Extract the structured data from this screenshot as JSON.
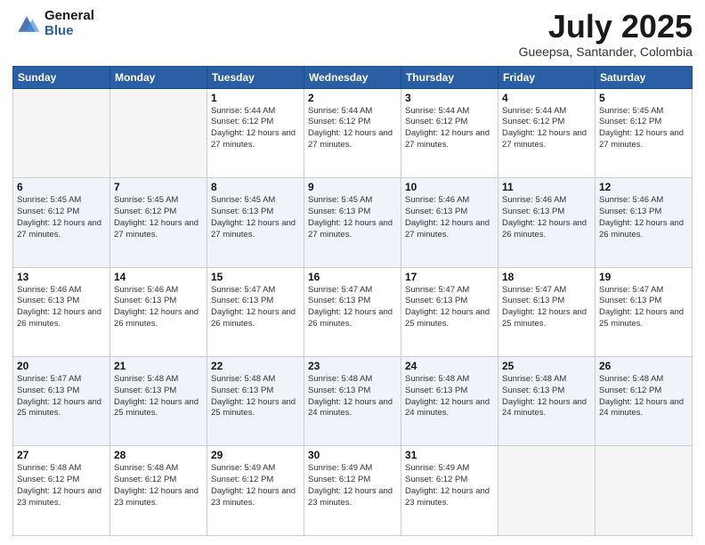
{
  "header": {
    "logo_general": "General",
    "logo_blue": "Blue",
    "month_title": "July 2025",
    "subtitle": "Gueepsa, Santander, Colombia"
  },
  "days_of_week": [
    "Sunday",
    "Monday",
    "Tuesday",
    "Wednesday",
    "Thursday",
    "Friday",
    "Saturday"
  ],
  "weeks": [
    [
      {
        "day": "",
        "sunrise": "",
        "sunset": "",
        "daylight": ""
      },
      {
        "day": "",
        "sunrise": "",
        "sunset": "",
        "daylight": ""
      },
      {
        "day": "1",
        "sunrise": "Sunrise: 5:44 AM",
        "sunset": "Sunset: 6:12 PM",
        "daylight": "Daylight: 12 hours and 27 minutes."
      },
      {
        "day": "2",
        "sunrise": "Sunrise: 5:44 AM",
        "sunset": "Sunset: 6:12 PM",
        "daylight": "Daylight: 12 hours and 27 minutes."
      },
      {
        "day": "3",
        "sunrise": "Sunrise: 5:44 AM",
        "sunset": "Sunset: 6:12 PM",
        "daylight": "Daylight: 12 hours and 27 minutes."
      },
      {
        "day": "4",
        "sunrise": "Sunrise: 5:44 AM",
        "sunset": "Sunset: 6:12 PM",
        "daylight": "Daylight: 12 hours and 27 minutes."
      },
      {
        "day": "5",
        "sunrise": "Sunrise: 5:45 AM",
        "sunset": "Sunset: 6:12 PM",
        "daylight": "Daylight: 12 hours and 27 minutes."
      }
    ],
    [
      {
        "day": "6",
        "sunrise": "Sunrise: 5:45 AM",
        "sunset": "Sunset: 6:12 PM",
        "daylight": "Daylight: 12 hours and 27 minutes."
      },
      {
        "day": "7",
        "sunrise": "Sunrise: 5:45 AM",
        "sunset": "Sunset: 6:12 PM",
        "daylight": "Daylight: 12 hours and 27 minutes."
      },
      {
        "day": "8",
        "sunrise": "Sunrise: 5:45 AM",
        "sunset": "Sunset: 6:13 PM",
        "daylight": "Daylight: 12 hours and 27 minutes."
      },
      {
        "day": "9",
        "sunrise": "Sunrise: 5:45 AM",
        "sunset": "Sunset: 6:13 PM",
        "daylight": "Daylight: 12 hours and 27 minutes."
      },
      {
        "day": "10",
        "sunrise": "Sunrise: 5:46 AM",
        "sunset": "Sunset: 6:13 PM",
        "daylight": "Daylight: 12 hours and 27 minutes."
      },
      {
        "day": "11",
        "sunrise": "Sunrise: 5:46 AM",
        "sunset": "Sunset: 6:13 PM",
        "daylight": "Daylight: 12 hours and 26 minutes."
      },
      {
        "day": "12",
        "sunrise": "Sunrise: 5:46 AM",
        "sunset": "Sunset: 6:13 PM",
        "daylight": "Daylight: 12 hours and 26 minutes."
      }
    ],
    [
      {
        "day": "13",
        "sunrise": "Sunrise: 5:46 AM",
        "sunset": "Sunset: 6:13 PM",
        "daylight": "Daylight: 12 hours and 26 minutes."
      },
      {
        "day": "14",
        "sunrise": "Sunrise: 5:46 AM",
        "sunset": "Sunset: 6:13 PM",
        "daylight": "Daylight: 12 hours and 26 minutes."
      },
      {
        "day": "15",
        "sunrise": "Sunrise: 5:47 AM",
        "sunset": "Sunset: 6:13 PM",
        "daylight": "Daylight: 12 hours and 26 minutes."
      },
      {
        "day": "16",
        "sunrise": "Sunrise: 5:47 AM",
        "sunset": "Sunset: 6:13 PM",
        "daylight": "Daylight: 12 hours and 26 minutes."
      },
      {
        "day": "17",
        "sunrise": "Sunrise: 5:47 AM",
        "sunset": "Sunset: 6:13 PM",
        "daylight": "Daylight: 12 hours and 25 minutes."
      },
      {
        "day": "18",
        "sunrise": "Sunrise: 5:47 AM",
        "sunset": "Sunset: 6:13 PM",
        "daylight": "Daylight: 12 hours and 25 minutes."
      },
      {
        "day": "19",
        "sunrise": "Sunrise: 5:47 AM",
        "sunset": "Sunset: 6:13 PM",
        "daylight": "Daylight: 12 hours and 25 minutes."
      }
    ],
    [
      {
        "day": "20",
        "sunrise": "Sunrise: 5:47 AM",
        "sunset": "Sunset: 6:13 PM",
        "daylight": "Daylight: 12 hours and 25 minutes."
      },
      {
        "day": "21",
        "sunrise": "Sunrise: 5:48 AM",
        "sunset": "Sunset: 6:13 PM",
        "daylight": "Daylight: 12 hours and 25 minutes."
      },
      {
        "day": "22",
        "sunrise": "Sunrise: 5:48 AM",
        "sunset": "Sunset: 6:13 PM",
        "daylight": "Daylight: 12 hours and 25 minutes."
      },
      {
        "day": "23",
        "sunrise": "Sunrise: 5:48 AM",
        "sunset": "Sunset: 6:13 PM",
        "daylight": "Daylight: 12 hours and 24 minutes."
      },
      {
        "day": "24",
        "sunrise": "Sunrise: 5:48 AM",
        "sunset": "Sunset: 6:13 PM",
        "daylight": "Daylight: 12 hours and 24 minutes."
      },
      {
        "day": "25",
        "sunrise": "Sunrise: 5:48 AM",
        "sunset": "Sunset: 6:13 PM",
        "daylight": "Daylight: 12 hours and 24 minutes."
      },
      {
        "day": "26",
        "sunrise": "Sunrise: 5:48 AM",
        "sunset": "Sunset: 6:12 PM",
        "daylight": "Daylight: 12 hours and 24 minutes."
      }
    ],
    [
      {
        "day": "27",
        "sunrise": "Sunrise: 5:48 AM",
        "sunset": "Sunset: 6:12 PM",
        "daylight": "Daylight: 12 hours and 23 minutes."
      },
      {
        "day": "28",
        "sunrise": "Sunrise: 5:48 AM",
        "sunset": "Sunset: 6:12 PM",
        "daylight": "Daylight: 12 hours and 23 minutes."
      },
      {
        "day": "29",
        "sunrise": "Sunrise: 5:49 AM",
        "sunset": "Sunset: 6:12 PM",
        "daylight": "Daylight: 12 hours and 23 minutes."
      },
      {
        "day": "30",
        "sunrise": "Sunrise: 5:49 AM",
        "sunset": "Sunset: 6:12 PM",
        "daylight": "Daylight: 12 hours and 23 minutes."
      },
      {
        "day": "31",
        "sunrise": "Sunrise: 5:49 AM",
        "sunset": "Sunset: 6:12 PM",
        "daylight": "Daylight: 12 hours and 23 minutes."
      },
      {
        "day": "",
        "sunrise": "",
        "sunset": "",
        "daylight": ""
      },
      {
        "day": "",
        "sunrise": "",
        "sunset": "",
        "daylight": ""
      }
    ]
  ]
}
